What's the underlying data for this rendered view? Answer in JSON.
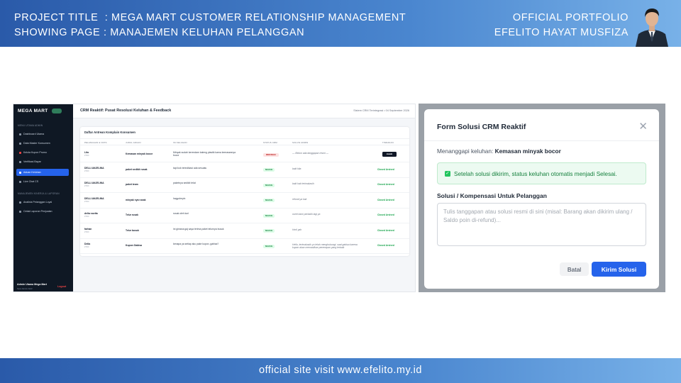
{
  "banner": {
    "project_line": "PROJECT TITLE  : MEGA MART CUSTOMER RELATIONSHIP MANAGEMENT",
    "page_line": "SHOWING PAGE : MANAJEMEN KELUHAN PELANGGAN",
    "portfolio": "OFFICIAL PORTFOLIO",
    "author": "EFELITO HAYAT MUSFIZA"
  },
  "footer": {
    "text": "official site visit www.efelito.my.id"
  },
  "app": {
    "brand": "MEGA MART",
    "sidebar": {
      "section1": "MENU UTAMA ADMIN",
      "items": [
        {
          "label": "Dashboard Utama"
        },
        {
          "label": "Data Master Konsumen"
        },
        {
          "label": "Kelola Kupon Promo"
        },
        {
          "label": "Verifikasi Bayar"
        },
        {
          "label": "Aduan Keluhan"
        },
        {
          "label": "Live Chat CS"
        }
      ],
      "section2": "MANAJEMEN KINERJA & LAPORAN",
      "items2": [
        {
          "label": "Analisis Pelanggan Loyal"
        },
        {
          "label": "Cetak Laporan Penjualan"
        }
      ],
      "footer_name": "Admin Utama Mega Mart",
      "footer_role": "Sesi Admin Aktif",
      "logout": "Logout"
    },
    "topbar": {
      "title": "CRM Reaktif: Pusat Resolusi Keluhan & Feedback",
      "system": "Sistem CRM Terintegrasi • 04 September 2026"
    },
    "table": {
      "title": "Daftar Antrean Komplain Konsumen",
      "headers": [
        "PELANGGAN & NOTA",
        "JUDUL ADUAN",
        "ISI KELUHAN",
        "STATUS CRM",
        "SOLUSI ADMIN",
        "TINDAKAN"
      ],
      "rows": [
        {
          "name": "Lito",
          "nota": "#TRX",
          "judul": "Kemasan minyak bocor",
          "isi": "Minyak sudah kerendam kaleng plastik karna kemasannya bocor",
          "status": "MENUNGGU",
          "solusi": "— Belum ada tanggapan resmi —",
          "tindakan": "Jawab"
        },
        {
          "name": "DELLI ANJELINA",
          "nota": "#TRX",
          "judul": "paket sedikit rusak",
          "isi": "tapi kok terindikasi ada sesuatu",
          "status": "SELESAI",
          "solusi": "baik kita",
          "tindakan": "Closed Arsived"
        },
        {
          "name": "DELLI ANJELINA",
          "nota": "#TRX",
          "judul": "paket team",
          "isi": "paketnya sedikit telat",
          "status": "SELESAI",
          "solusi": "baik kak terimakasih",
          "tindakan": "Closed Arsived"
        },
        {
          "name": "DELLI ANJELINA",
          "nota": "#TRX",
          "judul": "minyak nya rusak",
          "isi": "hagyoheyin",
          "status": "SELESAI",
          "solusi": "refund ya kak",
          "tindakan": "Closed Arsived"
        },
        {
          "name": "delia novita",
          "nota": "#TRX",
          "judul": "Telur rusak",
          "isi": "rusak oleh kuri",
          "status": "SELESAI",
          "solusi": "ooret kami perbaiki lagi ya",
          "tindakan": "Closed Arsived"
        },
        {
          "name": "farhan",
          "nota": "#TRX",
          "judul": "Telur busuk",
          "isi": "ini gimana gaj saya terima paket telurnya busuk",
          "status": "SELESAI",
          "solusi": "Hmil yah",
          "tindakan": "Closed Arsived"
        },
        {
          "name": "Delia",
          "nota": "#TRX",
          "judul": "Kupon Gabisa",
          "isi": "kenapa ya setiap aku pake kupon, gabisa?",
          "status": "SELESAI",
          "solusi": "Hello, terimakasih yo telah menghubungi, saat gabisa karena kupon akan memastikan penerapan yang terbaik",
          "tindakan": "Closed Arsived"
        }
      ]
    }
  },
  "modal": {
    "title": "Form Solusi CRM Reaktif",
    "responding_label": "Menanggapi keluhan:",
    "responding_value": "Kemasan minyak bocor",
    "alert": "Setelah solusi dikirim, status keluhan otomatis menjadi Selesai.",
    "field_label": "Solusi / Kompensasi Untuk Pelanggan",
    "placeholder": "Tulis tanggapan atau solusi resmi di sini (misal: Barang akan dikirim ulang / Saldo poin di-refund)...",
    "cancel": "Batal",
    "submit": "Kirim Solusi",
    "close_icon": "close-icon",
    "check_icon": "check-icon"
  },
  "colors": {
    "accent": "#2563eb",
    "sidebar": "#0f1824",
    "banner_start": "#2a5aa9",
    "banner_end": "#78b1e8",
    "success": "#15803d"
  }
}
